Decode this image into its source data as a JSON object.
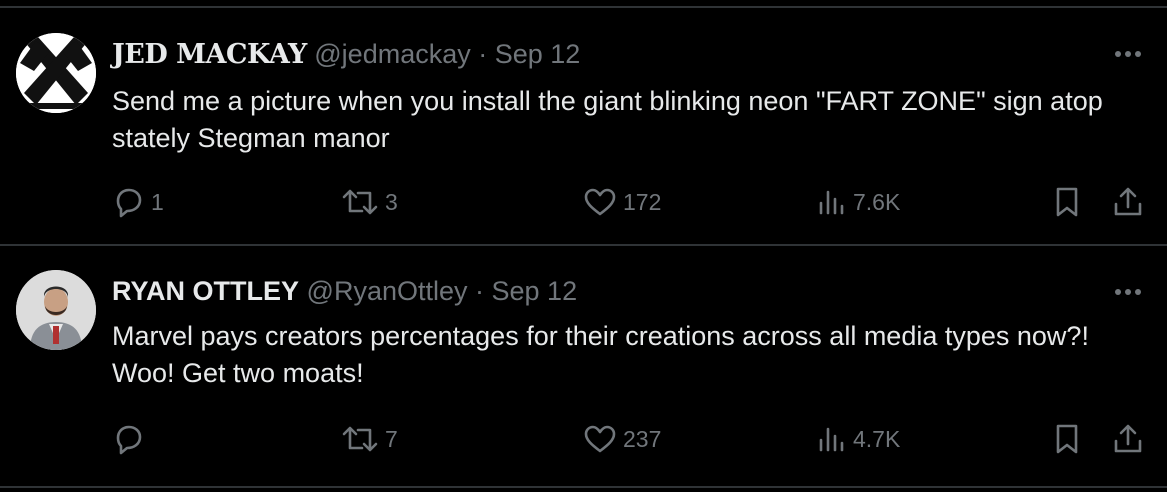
{
  "tweets": [
    {
      "display_name": "JED MACKAY",
      "handle": "@jedmackay",
      "separator": " · ",
      "date": "Sep 12",
      "text": "Send me a picture when you install the giant blinking neon \"FART ZONE\" sign atop stately Stegman manor",
      "replies": "1",
      "retweets": "3",
      "likes": "172",
      "views": "7.6K"
    },
    {
      "display_name": "RYAN OTTLEY",
      "handle": "@RyanOttley",
      "separator": " · ",
      "date": "Sep 12",
      "text": "Marvel pays creators percentages for their creations across all media types now?! Woo! Get two moats!",
      "replies": "",
      "retweets": "7",
      "likes": "237",
      "views": "4.7K"
    }
  ],
  "colors": {
    "background": "#000000",
    "text_primary": "#e7e9ea",
    "text_secondary": "#71767b",
    "divider": "#2f3336"
  },
  "icons": [
    "reply-icon",
    "retweet-icon",
    "like-icon",
    "views-icon",
    "bookmark-icon",
    "share-icon",
    "more-icon"
  ]
}
